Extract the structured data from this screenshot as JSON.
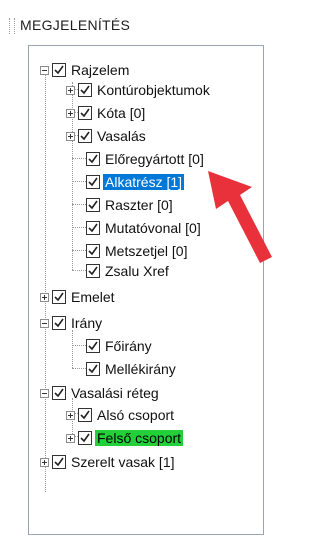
{
  "panel": {
    "title": "MEGJELENÍTÉS"
  },
  "tree": [
    {
      "label": "Rajzelem",
      "toggle": "minus",
      "checked": true
    },
    {
      "label": "Kontúrobjektumok",
      "toggle": "plus",
      "checked": true
    },
    {
      "label": "Kóta [0]",
      "toggle": "plus",
      "checked": true
    },
    {
      "label": "Vasalás",
      "toggle": "plus",
      "checked": true
    },
    {
      "label": "Előregyártott [0]",
      "toggle": null,
      "checked": true
    },
    {
      "label": "Alkatrész [1]",
      "toggle": null,
      "checked": true,
      "state": "selected"
    },
    {
      "label": "Raszter [0]",
      "toggle": null,
      "checked": true
    },
    {
      "label": "Mutatóvonal [0]",
      "toggle": null,
      "checked": true
    },
    {
      "label": "Metszetjel [0]",
      "toggle": null,
      "checked": true
    },
    {
      "label": "Zsalu Xref",
      "toggle": null,
      "checked": true
    },
    {
      "label": "Emelet",
      "toggle": "plus",
      "checked": true
    },
    {
      "label": "Irány",
      "toggle": "minus",
      "checked": true
    },
    {
      "label": "Főirány",
      "toggle": null,
      "checked": true
    },
    {
      "label": "Mellékirány",
      "toggle": null,
      "checked": true
    },
    {
      "label": "Vasalási réteg",
      "toggle": "minus",
      "checked": true
    },
    {
      "label": "Alsó csoport",
      "toggle": "plus",
      "checked": true
    },
    {
      "label": "Felső csoport",
      "toggle": "plus",
      "checked": true,
      "state": "highlight"
    },
    {
      "label": "Szerelt vasak [1]",
      "toggle": "plus",
      "checked": true
    }
  ],
  "colors": {
    "selection": "#0078d7",
    "highlight": "#22d13a",
    "arrow": "#e8313a"
  },
  "icons": [
    "toggle-icon",
    "checkbox-checkmark-icon",
    "pointer-arrow-icon"
  ]
}
